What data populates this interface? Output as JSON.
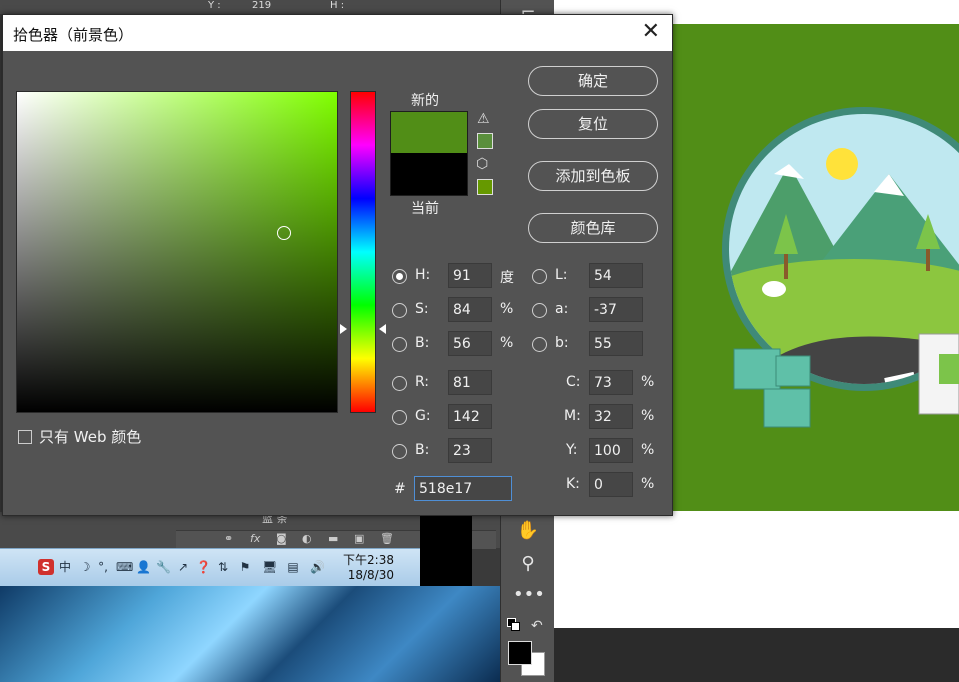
{
  "dialog": {
    "title": "拾色器（前景色）",
    "close_glyph": "✕",
    "label_new": "新的",
    "label_current": "当前",
    "new_color": "#518e17",
    "current_color": "#000000",
    "gamut_warning_color": "#5a8f3c",
    "web_safe_color": "#669900",
    "buttons": {
      "ok": "确定",
      "reset": "复位",
      "add_swatch": "添加到色板",
      "libraries": "颜色库"
    },
    "web_only_label": "只有 Web 颜色",
    "hsb": {
      "h": {
        "label": "H:",
        "value": "91",
        "unit": "度",
        "selected": true
      },
      "s": {
        "label": "S:",
        "value": "84",
        "unit": "%"
      },
      "b": {
        "label": "B:",
        "value": "56",
        "unit": "%"
      }
    },
    "rgb": {
      "r": {
        "label": "R:",
        "value": "81"
      },
      "g": {
        "label": "G:",
        "value": "142"
      },
      "b": {
        "label": "B:",
        "value": "23"
      }
    },
    "lab": {
      "l": {
        "label": "L:",
        "value": "54"
      },
      "a": {
        "label": "a:",
        "value": "-37"
      },
      "b": {
        "label": "b:",
        "value": "55"
      }
    },
    "cmyk": {
      "c": {
        "label": "C:",
        "value": "73",
        "unit": "%"
      },
      "m": {
        "label": "M:",
        "value": "32",
        "unit": "%"
      },
      "y": {
        "label": "Y:",
        "value": "100",
        "unit": "%"
      },
      "k": {
        "label": "K:",
        "value": "0",
        "unit": "%"
      }
    },
    "hex": {
      "label": "#",
      "value": "518e17"
    }
  },
  "background": {
    "info_y_label": "Y :",
    "info_y_value": "219",
    "info_h_label": "H :",
    "layers_item": "蓝 条",
    "tray_clock_time": "下午2:38",
    "tray_clock_date": "18/8/30",
    "ime_label": "中",
    "ime_logo": "S",
    "document_color": "#518e17"
  }
}
